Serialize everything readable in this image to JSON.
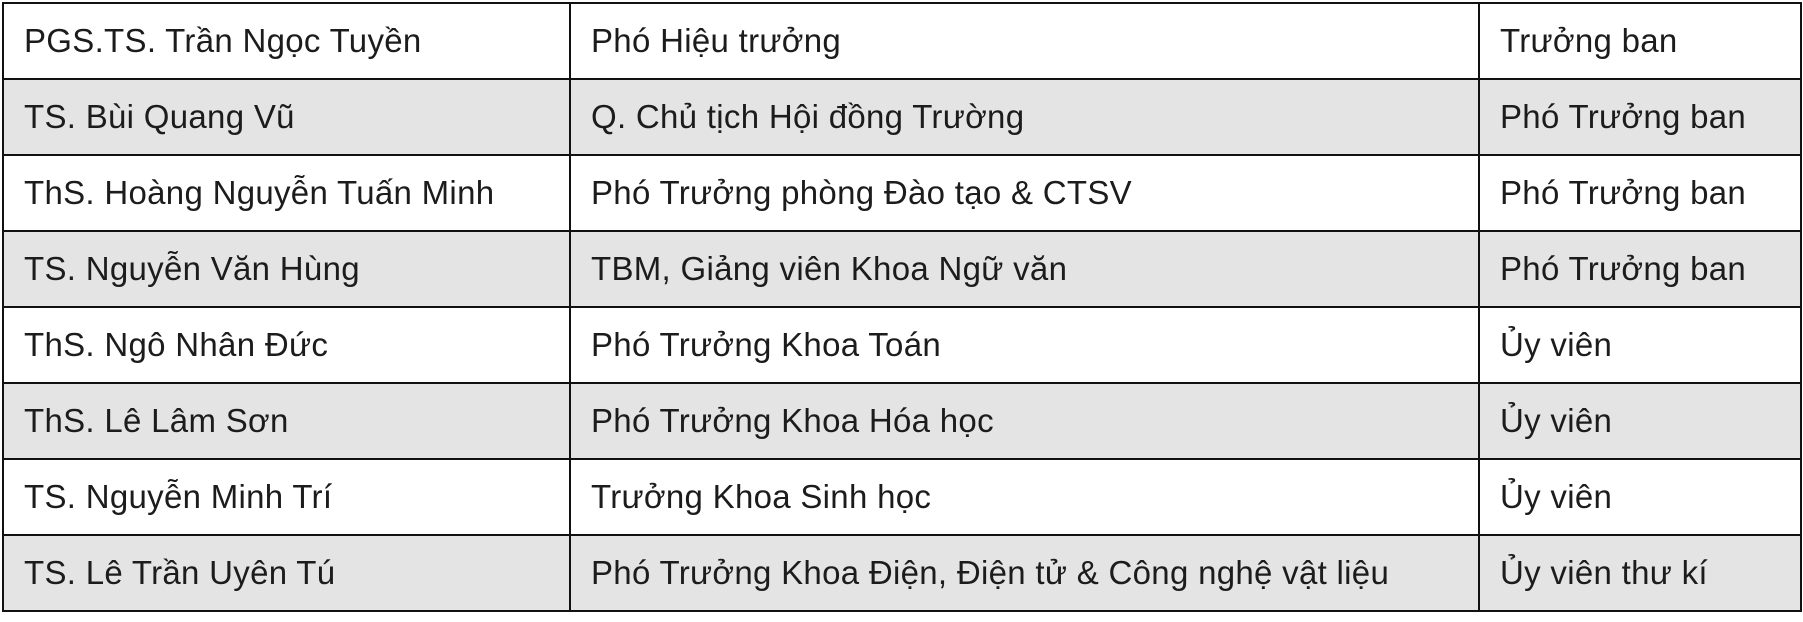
{
  "table": {
    "rows": [
      {
        "name": "PGS.TS. Trần Ngọc Tuyền",
        "position": "Phó Hiệu trưởng",
        "role": "Trưởng ban"
      },
      {
        "name": "TS. Bùi Quang Vũ",
        "position": "Q. Chủ tịch Hội đồng Trường",
        "role": "Phó Trưởng ban"
      },
      {
        "name": "ThS. Hoàng Nguyễn Tuấn Minh",
        "position": "Phó Trưởng phòng Đào tạo & CTSV",
        "role": "Phó Trưởng ban"
      },
      {
        "name": "TS. Nguyễn Văn Hùng",
        "position": "TBM, Giảng viên Khoa Ngữ văn",
        "role": "Phó Trưởng ban"
      },
      {
        "name": "ThS. Ngô Nhân Đức",
        "position": "Phó Trưởng Khoa Toán",
        "role": "Ủy viên"
      },
      {
        "name": "ThS. Lê Lâm Sơn",
        "position": "Phó Trưởng Khoa Hóa học",
        "role": "Ủy viên"
      },
      {
        "name": "TS. Nguyễn Minh Trí",
        "position": "Trưởng Khoa Sinh học",
        "role": "Ủy viên"
      },
      {
        "name": "TS. Lê Trần Uyên Tú",
        "position": "Phó Trưởng Khoa Điện, Điện tử & Công nghệ vật liệu",
        "role": "Ủy viên thư kí"
      }
    ],
    "colors": {
      "shaded_row": "#e4e4e4",
      "plain_row": "#ffffff",
      "border": "#111111",
      "text": "#1c1c1c"
    }
  }
}
